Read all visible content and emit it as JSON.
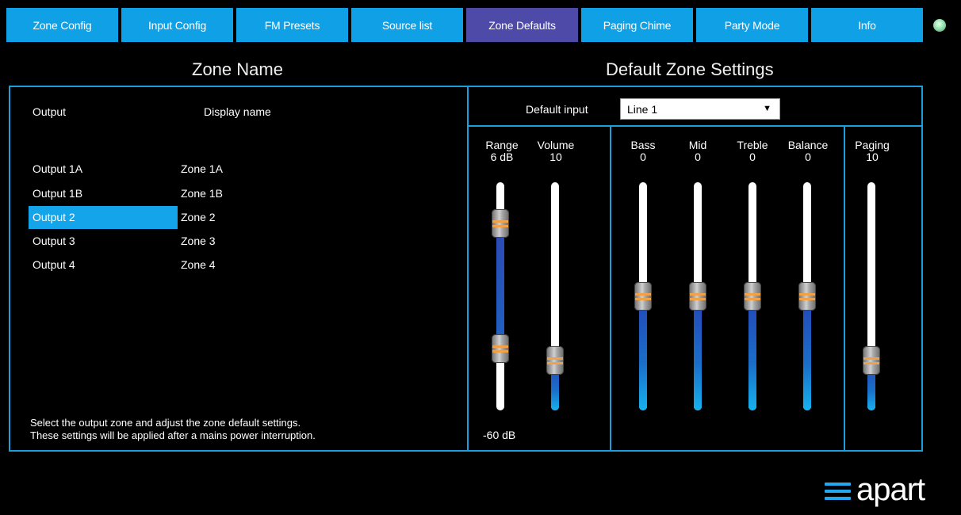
{
  "tabs": [
    {
      "label": "Zone Config",
      "active": false
    },
    {
      "label": "Input Config",
      "active": false
    },
    {
      "label": "FM Presets",
      "active": false
    },
    {
      "label": "Source list",
      "active": false
    },
    {
      "label": "Zone Defaults",
      "active": true
    },
    {
      "label": "Paging Chime",
      "active": false
    },
    {
      "label": "Party Mode",
      "active": false
    },
    {
      "label": "Info",
      "active": false
    }
  ],
  "status_indicator_icon": "status-led-icon",
  "zone_panel": {
    "title": "Zone Name",
    "col_output": "Output",
    "col_display": "Display name",
    "rows": [
      {
        "output": "Output 1A",
        "name": "Zone 1A",
        "selected": false
      },
      {
        "output": "Output 1B",
        "name": "Zone 1B",
        "selected": false
      },
      {
        "output": "Output 2",
        "name": "Zone 2",
        "selected": true
      },
      {
        "output": "Output 3",
        "name": "Zone 3",
        "selected": false
      },
      {
        "output": "Output 4",
        "name": "Zone 4",
        "selected": false
      }
    ],
    "hint_line1": "Select the output zone and adjust the zone default settings.",
    "hint_line2": "These settings will be applied after a mains power interruption."
  },
  "settings": {
    "title": "Default Zone Settings",
    "default_input_label": "Default input",
    "default_input_value": "Line 1",
    "sliders": {
      "range": {
        "name": "Range",
        "value": "6 dB",
        "bottom_label": "-60 dB",
        "upper_level": 0.82,
        "lower_level": 0.27
      },
      "volume": {
        "name": "Volume",
        "value": "10",
        "level": 0.22
      },
      "bass": {
        "name": "Bass",
        "value": "0",
        "level": 0.5
      },
      "mid": {
        "name": "Mid",
        "value": "0",
        "level": 0.5
      },
      "treble": {
        "name": "Treble",
        "value": "0",
        "level": 0.5
      },
      "balance": {
        "name": "Balance",
        "value": "0",
        "level": 0.5
      },
      "paging": {
        "name": "Paging",
        "value": "10",
        "level": 0.22
      }
    }
  },
  "brand": "apart",
  "accent_color": "#10a0e6",
  "active_tab_color": "#4d4aa8"
}
